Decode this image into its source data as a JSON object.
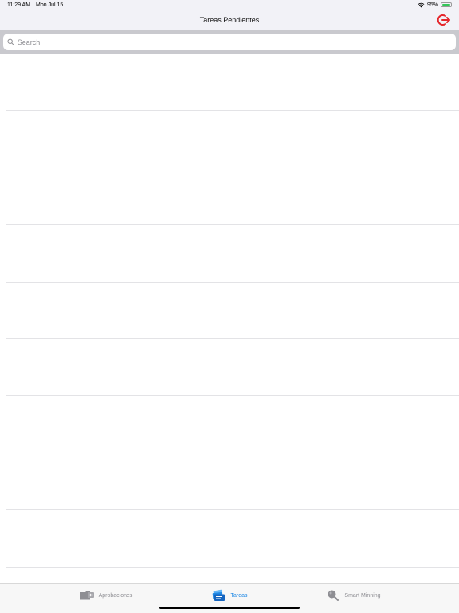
{
  "status": {
    "time": "11:29 AM",
    "date": "Mon Jul 15",
    "battery": "95%",
    "battery_level": 0.95
  },
  "nav": {
    "title": "Tareas Pendientes",
    "logout_icon": "power-logout-icon",
    "logout_color": "#e5262b"
  },
  "search": {
    "placeholder": "Search",
    "value": ""
  },
  "list": {
    "row_count": 9
  },
  "tabs": [
    {
      "label": "Aprobaciones",
      "icon": "folder-approve-icon",
      "active": false
    },
    {
      "label": "Tareas",
      "icon": "tasks-cards-icon",
      "active": true
    },
    {
      "label": "Smart Minning",
      "icon": "magnifier-icon",
      "active": false
    }
  ],
  "colors": {
    "accent": "#1e88e5",
    "inactive": "#8e8e93",
    "logout": "#e5262b"
  }
}
